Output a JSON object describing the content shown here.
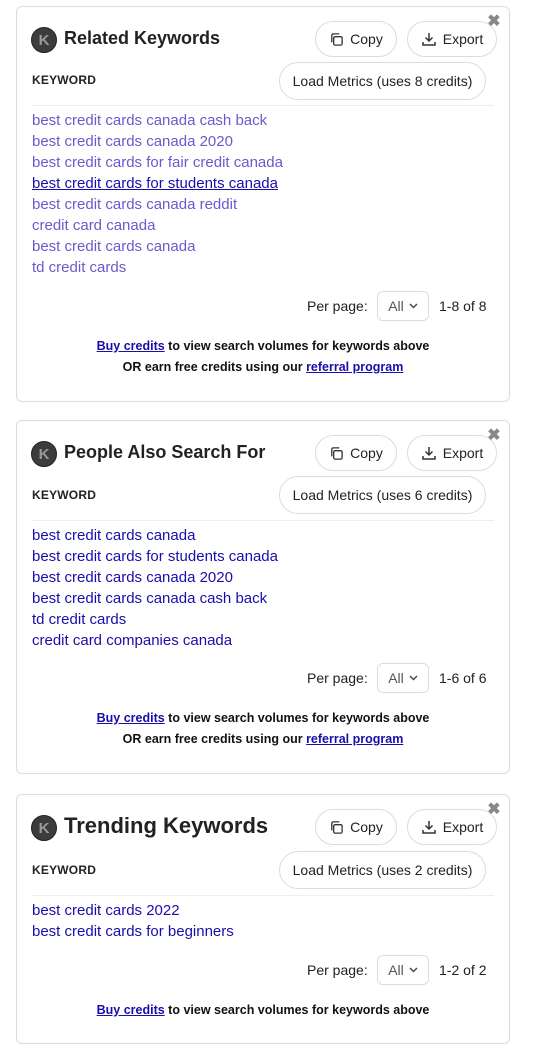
{
  "panels": [
    {
      "title": "Related Keywords",
      "logo_letter": "K",
      "copy_label": "Copy",
      "export_label": "Export",
      "close_glyph": "✖",
      "column_header": "KEYWORD",
      "load_metrics_label": "Load Metrics (uses 8 credits)",
      "keywords": [
        "best credit cards canada cash back",
        "best credit cards canada 2020",
        "best credit cards for fair credit canada",
        "best credit cards for students canada",
        "best credit cards canada reddit",
        "credit card canada",
        "best credit cards canada",
        "td credit cards"
      ],
      "per_page_label": "Per page:",
      "per_page_value": "All",
      "range": "1-8 of 8",
      "buy_credits_link": "Buy credits",
      "buy_credits_text": " to view search volumes for keywords above",
      "earn_text": "OR earn free credits using our ",
      "referral_link": "referral program"
    },
    {
      "title": "People Also Search For",
      "logo_letter": "K",
      "copy_label": "Copy",
      "export_label": "Export",
      "close_glyph": "✖",
      "column_header": "KEYWORD",
      "load_metrics_label": "Load Metrics (uses 6 credits)",
      "keywords": [
        "best credit cards canada",
        "best credit cards for students canada",
        "best credit cards canada 2020",
        "best credit cards canada cash back",
        "td credit cards",
        "credit card companies canada"
      ],
      "per_page_label": "Per page:",
      "per_page_value": "All",
      "range": "1-6 of 6",
      "buy_credits_link": "Buy credits",
      "buy_credits_text": " to view search volumes for keywords above",
      "earn_text": "OR earn free credits using our ",
      "referral_link": "referral program"
    },
    {
      "title": "Trending Keywords",
      "logo_letter": "K",
      "copy_label": "Copy",
      "export_label": "Export",
      "close_glyph": "✖",
      "column_header": "KEYWORD",
      "load_metrics_label": "Load Metrics (uses 2 credits)",
      "keywords": [
        "best credit cards 2022",
        "best credit cards for beginners"
      ],
      "per_page_label": "Per page:",
      "per_page_value": "All",
      "range": "1-2 of 2",
      "buy_credits_link": "Buy credits",
      "buy_credits_text": " to view search volumes for keywords above"
    }
  ],
  "colors": {
    "link_visited": "#6a5acd",
    "link": "#1a0dab",
    "border": "#dadce0"
  }
}
